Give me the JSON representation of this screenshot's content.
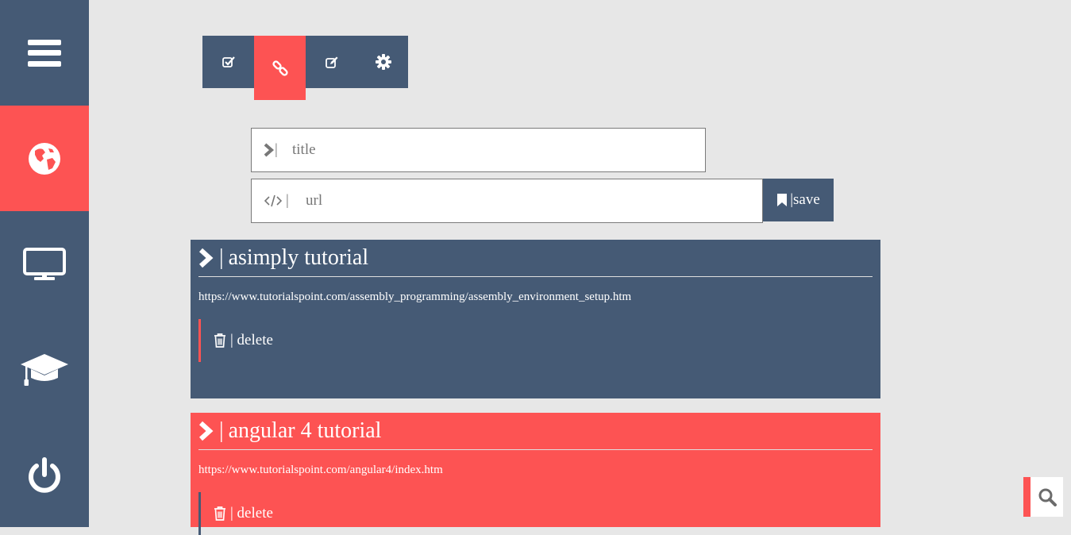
{
  "sidebar": {
    "items": [
      {
        "icon": "menu-icon"
      },
      {
        "icon": "globe-icon",
        "active": true
      },
      {
        "icon": "monitor-icon"
      },
      {
        "icon": "graduation-cap-icon"
      },
      {
        "icon": "power-icon"
      }
    ]
  },
  "tabs": [
    {
      "icon": "checkbox-icon"
    },
    {
      "icon": "link-icon",
      "active": true
    },
    {
      "icon": "edit-icon"
    },
    {
      "icon": "gear-icon"
    }
  ],
  "form": {
    "title_prefix": "|",
    "title_placeholder": "title",
    "url_prefix": "|",
    "url_placeholder": "url",
    "save_label": "|save"
  },
  "cards": [
    {
      "separator": "|",
      "title": "asimply tutorial",
      "url": "https://www.tutorialspoint.com/assembly_programming/assembly_environment_setup.htm",
      "delete_label": "| delete"
    },
    {
      "separator": "|",
      "title": "angular 4 tutorial",
      "url": "https://www.tutorialspoint.com/angular4/index.htm",
      "delete_label": "| delete"
    }
  ],
  "colors": {
    "navy": "#455a75",
    "accent": "#fd5353",
    "background": "#e7e7e7"
  }
}
